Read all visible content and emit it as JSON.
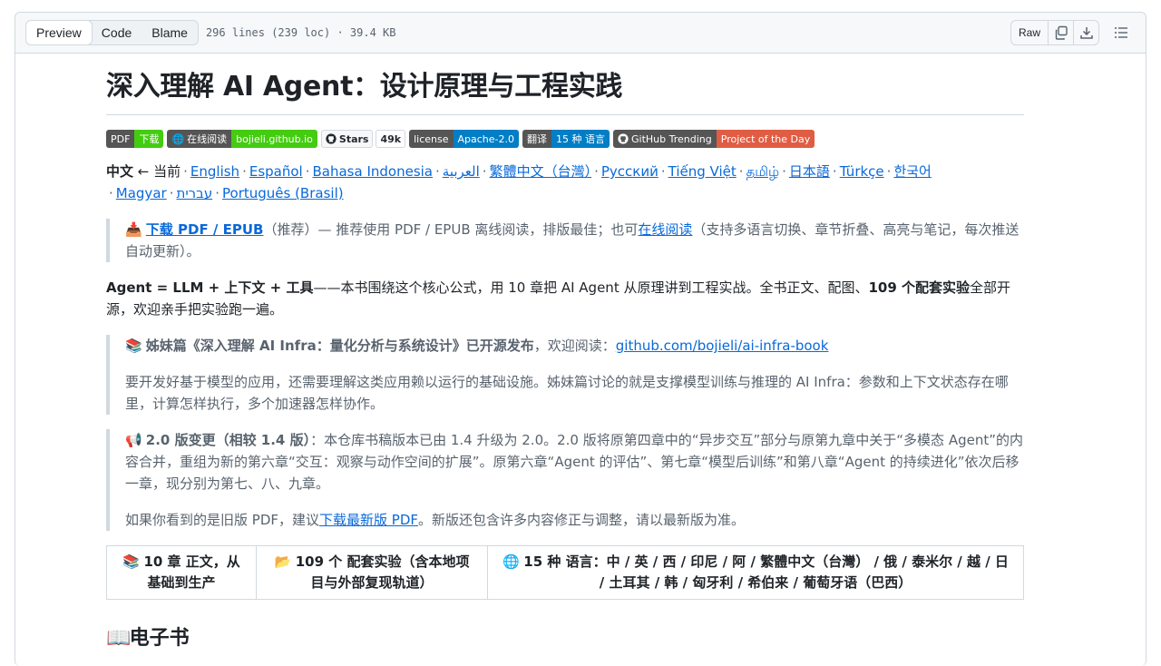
{
  "filebar": {
    "tabs": [
      "Preview",
      "Code",
      "Blame"
    ],
    "meta": "296 lines (239 loc) · 39.4 KB",
    "raw_label": "Raw"
  },
  "title": "深入理解 AI Agent：设计原理与工程实践",
  "badges": {
    "pdf": {
      "left": "PDF",
      "right": "下载"
    },
    "read": {
      "left": "在线阅读",
      "right": "bojieli.github.io"
    },
    "stars": {
      "label": "Stars",
      "count": "49k"
    },
    "license": {
      "left": "license",
      "right": "Apache-2.0"
    },
    "translate": {
      "left": "翻译",
      "right": "15 种 语言"
    },
    "trending": {
      "left": "GitHub Trending",
      "right": "Project of the Day"
    }
  },
  "langs": {
    "current": "中文",
    "current_suffix": " ← 当前",
    "links": [
      "English",
      "Español",
      "Bahasa Indonesia",
      "العربية",
      "繁體中文（台灣）",
      "Русский",
      "Tiếng Việt",
      "தமிழ்",
      "日本語",
      "Türkçe",
      "한국어",
      "Magyar",
      "עברית",
      "Português (Brasil)"
    ]
  },
  "quote1": {
    "link": "下载 PDF / EPUB",
    "text1": "（推荐）— 推荐使用 PDF / EPUB 离线阅读，排版最佳；也可",
    "link2": "在线阅读",
    "text2": "（支持多语言切换、章节折叠、高亮与笔记，每次推送自动更新）。"
  },
  "intro": {
    "bold1": "Agent = LLM + 上下文 + 工具",
    "text1": "——本书围绕这个核心公式，用 10 章把 AI Agent 从原理讲到工程实战。全书正文、配图、",
    "bold2": "109 个配套实验",
    "text2": "全部开源，欢迎亲手把实验跑一遍。"
  },
  "quote2": {
    "bold": "姊妹篇《深入理解 AI Infra：量化分析与系统设计》已开源发布",
    "text": "，欢迎阅读：",
    "link": "github.com/bojieli/ai-infra-book",
    "para2": "要开发好基于模型的应用，还需要理解这类应用赖以运行的基础设施。姊妹篇讨论的就是支撑模型训练与推理的 AI Infra：参数和上下文状态存在哪里，计算怎样执行，多个加速器怎样协作。"
  },
  "quote3": {
    "bold": "2.0 版变更（相较 1.4 版）",
    "text": "：本仓库书稿版本已由 1.4 升级为 2.0。2.0 版将原第四章中的“异步交互”部分与原第九章中关于“多模态 Agent”的内容合并，重组为新的第六章“交互：观察与动作空间的扩展”。原第六章“Agent 的评估”、第七章“模型后训练”和第八章“Agent 的持续进化”依次后移一章，现分别为第七、八、九章。",
    "p2_text1": "如果你看到的是旧版 PDF，建议",
    "p2_link": "下载最新版 PDF",
    "p2_text2": "。新版还包含许多内容修正与调整，请以最新版为准。"
  },
  "table": {
    "cells": [
      "10 章 正文，从基础到生产",
      "109 个 配套实验（含本地项目与外部复现轨道）",
      "15 种 语言：中 / 英 / 西 / 印尼 / 阿 / 繁體中文（台灣） / 俄 / 泰米尔 / 越 / 日 / 土耳其 / 韩 / 匈牙利 / 希伯来 / 葡萄牙语（巴西）"
    ]
  },
  "next_heading": "电子书",
  "colors": {
    "link": "#0969da",
    "border": "#d1d9e0",
    "badge_dark": "#555555",
    "badge_green": "#4c1",
    "badge_blue": "#007ec6",
    "badge_orange": "#e05d44"
  }
}
